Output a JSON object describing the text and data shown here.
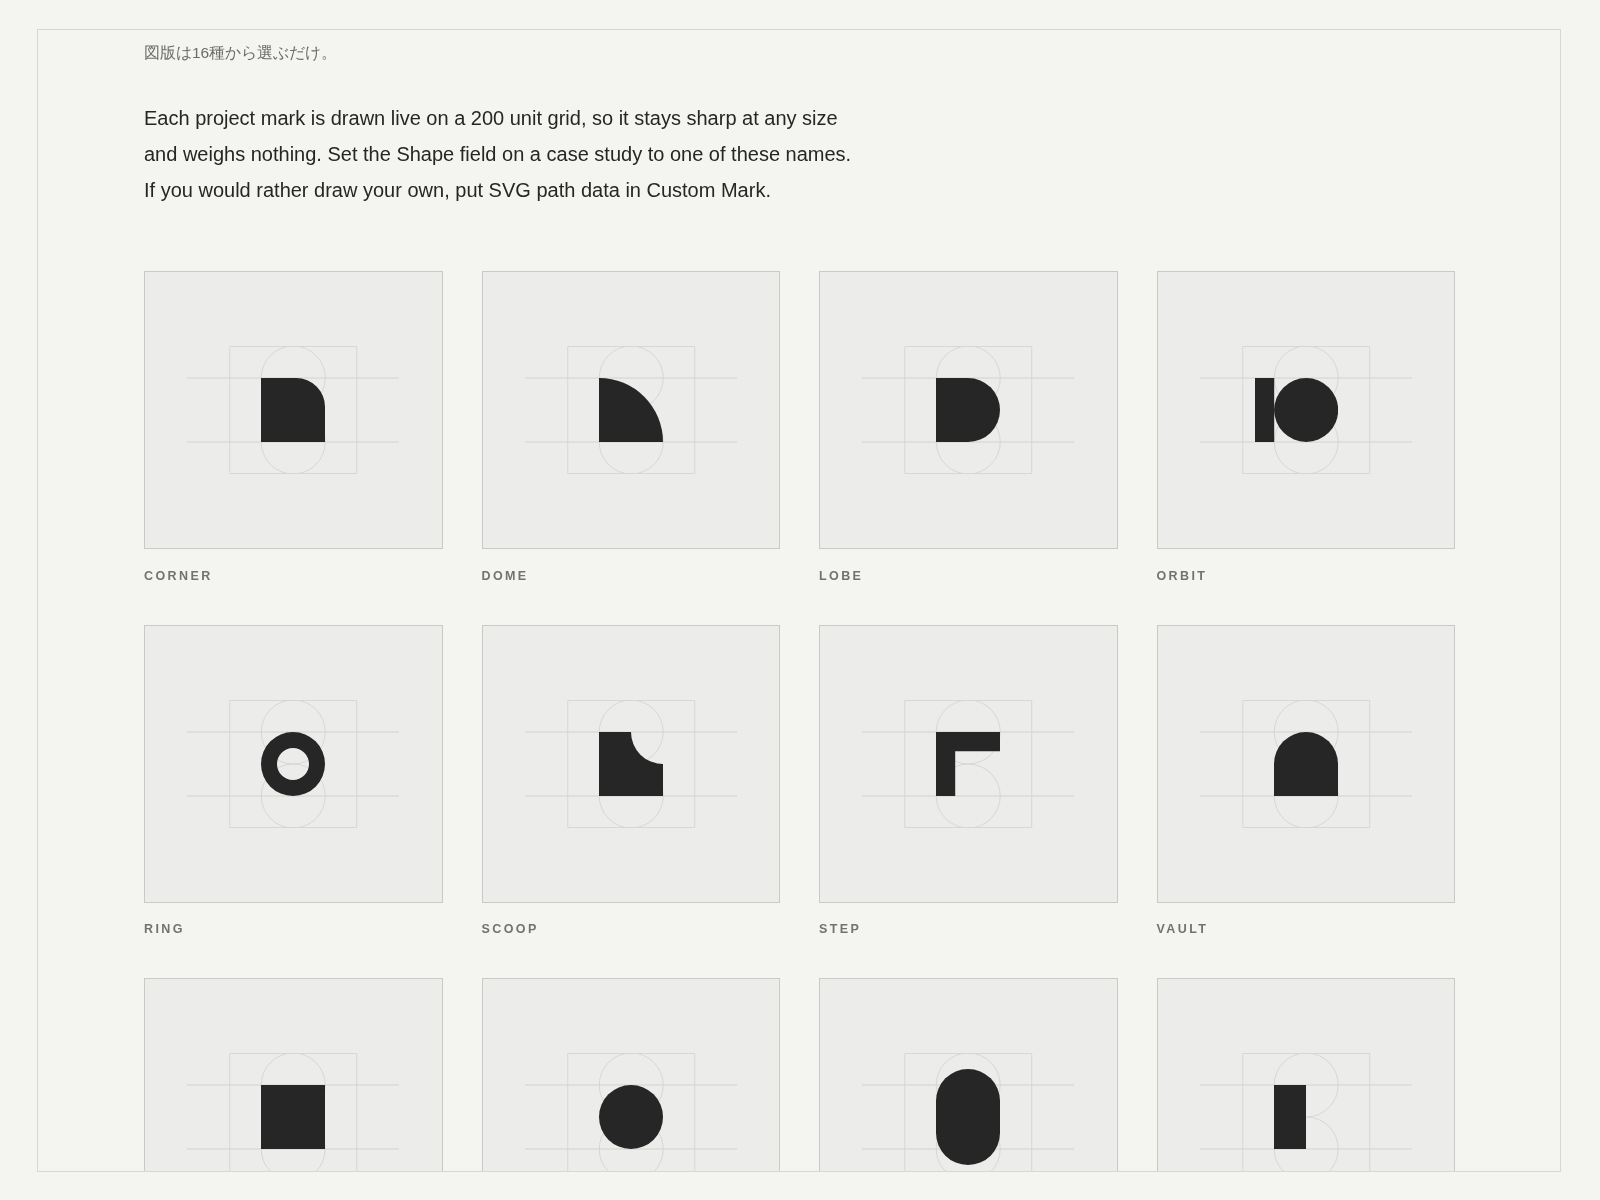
{
  "caption": "図版は16種から選ぶだけ。",
  "intro": "Each project mark is drawn live on a 200 unit grid, so it stays sharp at any size and weighs nothing. Set the Shape field on a case study to one of these names. If you would rather draw your own, put SVG path data in Custom Mark.",
  "marks": [
    {
      "kind": "corner",
      "label": "CORNER"
    },
    {
      "kind": "dome",
      "label": "DOME"
    },
    {
      "kind": "lobe",
      "label": "LOBE"
    },
    {
      "kind": "orbit",
      "label": "ORBIT"
    },
    {
      "kind": "ring",
      "label": "RING"
    },
    {
      "kind": "scoop",
      "label": "SCOOP"
    },
    {
      "kind": "step",
      "label": "STEP"
    },
    {
      "kind": "vault",
      "label": "VAULT"
    },
    {
      "kind": "square"
    },
    {
      "kind": "circle"
    },
    {
      "kind": "pill"
    },
    {
      "kind": "bar"
    }
  ]
}
